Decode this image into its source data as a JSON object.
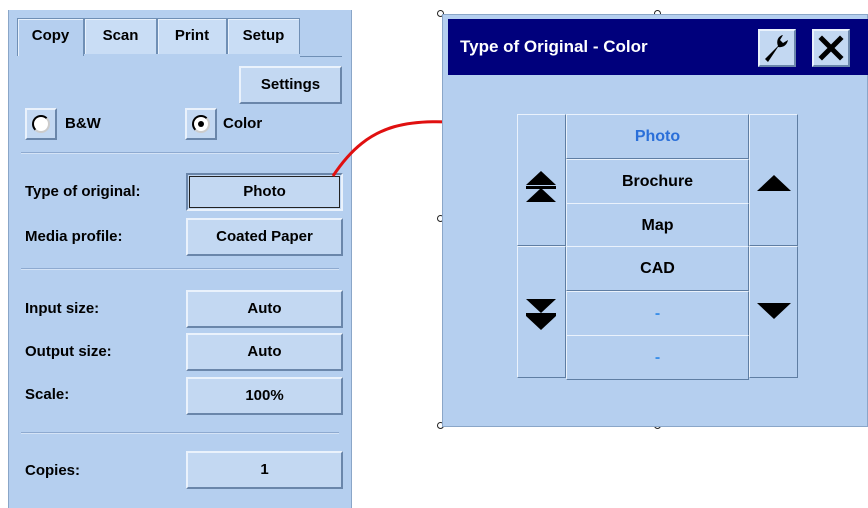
{
  "left_panel": {
    "tabs": [
      {
        "label": "Copy",
        "active": true
      },
      {
        "label": "Scan",
        "active": false
      },
      {
        "label": "Print",
        "active": false
      },
      {
        "label": "Setup",
        "active": false
      }
    ],
    "settings_button": "Settings",
    "color_mode": {
      "bw_label": "B&W",
      "color_label": "Color",
      "selected": "Color"
    },
    "fields": {
      "type_of_original": {
        "label": "Type of original:",
        "value": "Photo"
      },
      "media_profile": {
        "label": "Media profile:",
        "value": "Coated Paper"
      },
      "input_size": {
        "label": "Input size:",
        "value": "Auto"
      },
      "output_size": {
        "label": "Output size:",
        "value": "Auto"
      },
      "scale": {
        "label": "Scale:",
        "value": "100%"
      },
      "copies": {
        "label": "Copies:",
        "value": "1"
      }
    }
  },
  "dialog": {
    "title": "Type of Original - Color",
    "title_buttons": {
      "settings_icon": "wrench-icon",
      "close_icon": "close-icon"
    },
    "options": [
      {
        "label": "Photo",
        "selected": true
      },
      {
        "label": "Brochure",
        "selected": false
      },
      {
        "label": "Map",
        "selected": false
      },
      {
        "label": "CAD",
        "selected": false
      },
      {
        "label": "-",
        "selected": false
      },
      {
        "label": "-",
        "selected": false
      }
    ],
    "scroll_icons": {
      "page_up": "double-up-icon",
      "page_down": "double-down-icon",
      "line_up": "up-triangle-icon",
      "line_down": "down-triangle-icon"
    }
  },
  "colors": {
    "panel_bg": "#b5cfef",
    "title_bar": "#00007c",
    "selected_text": "#2a6fd9",
    "placeholder_text": "#3b8fe8",
    "connector_arrow": "#e01010"
  }
}
